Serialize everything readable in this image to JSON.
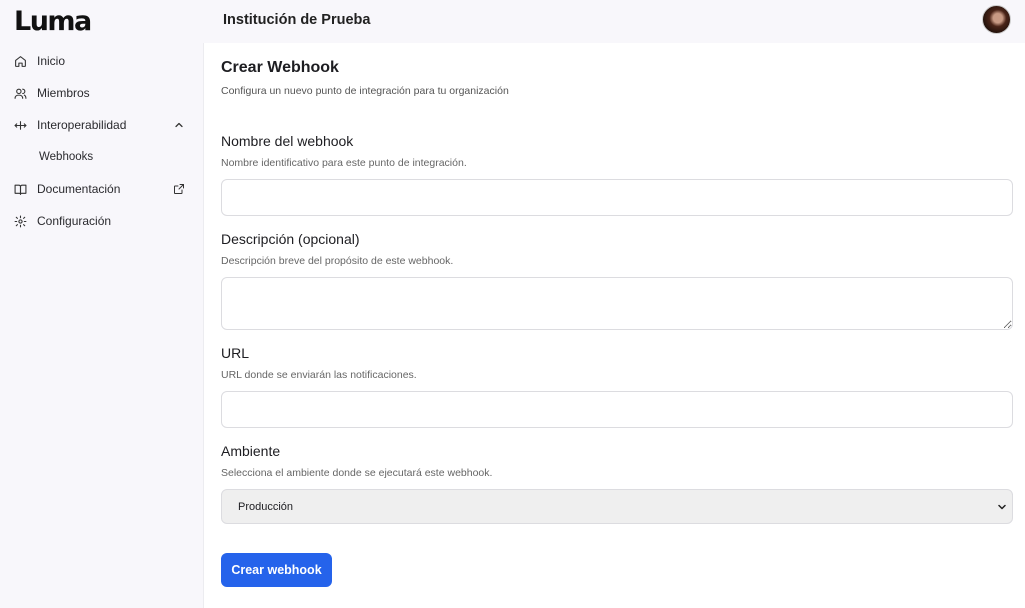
{
  "app": {
    "logo": "Luma"
  },
  "header": {
    "org_title": "Institución de Prueba"
  },
  "sidebar": {
    "items": [
      {
        "label": "Inicio",
        "icon": "home-icon"
      },
      {
        "label": "Miembros",
        "icon": "users-icon"
      },
      {
        "label": "Interoperabilidad",
        "icon": "move-icon",
        "expanded": true
      },
      {
        "label": "Webhooks",
        "sub": true
      },
      {
        "label": "Documentación",
        "icon": "book-icon",
        "external": true
      },
      {
        "label": "Configuración",
        "icon": "gear-icon"
      }
    ]
  },
  "form": {
    "title": "Crear Webhook",
    "subtitle": "Configura un nuevo punto de integración para tu organización",
    "name": {
      "label": "Nombre del webhook",
      "help": "Nombre identificativo para este punto de integración.",
      "value": "",
      "placeholder": ""
    },
    "description": {
      "label": "Descripción (opcional)",
      "help": "Descripción breve del propósito de este webhook.",
      "value": "",
      "placeholder": ""
    },
    "url": {
      "label": "URL",
      "help": "URL donde se enviarán las notificaciones.",
      "value": "",
      "placeholder": ""
    },
    "environment": {
      "label": "Ambiente",
      "help": "Selecciona el ambiente donde se ejecutará este webhook.",
      "selected": "Producción"
    },
    "submit_label": "Crear webhook"
  },
  "colors": {
    "primary": "#2563eb",
    "sidebar_bg": "#f8f7fb",
    "main_bg": "#ffffff"
  }
}
